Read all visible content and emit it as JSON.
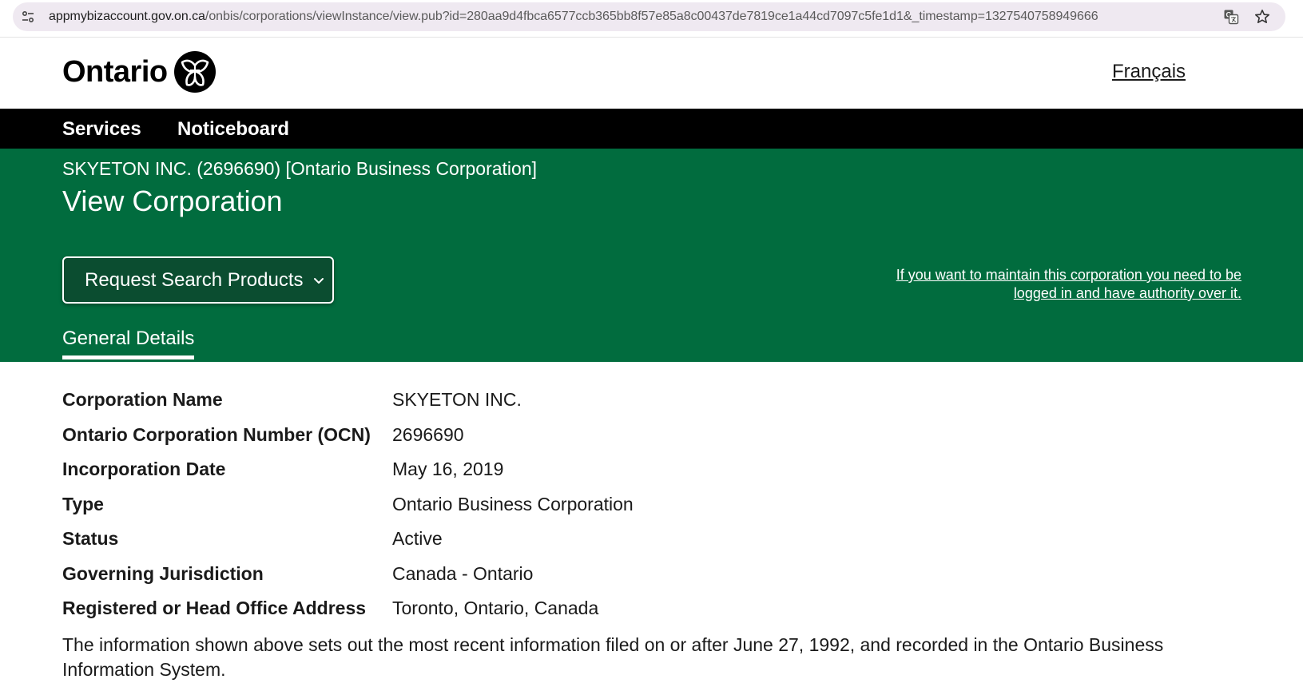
{
  "browser": {
    "url_host": "appmybizaccount.gov.on.ca",
    "url_path": "/onbis/corporations/viewInstance/view.pub?id=280aa9d4fbca6577ccb365bb8f57e85a8c00437de7819ce1a44cd7097c5fe1d1&_timestamp=1327540758949666",
    "icons": [
      "site-info-icon",
      "translate-icon",
      "star-icon"
    ]
  },
  "header": {
    "logo_text": "Ontario",
    "language_link": "Français"
  },
  "nav": {
    "items": [
      {
        "label": "Services"
      },
      {
        "label": "Noticeboard"
      }
    ]
  },
  "banner": {
    "subtitle": "SKYETON INC. (2696690) [Ontario Business Corporation]",
    "title": "View Corporation",
    "request_button": "Request Search Products",
    "maintain_link": "If you want to maintain this corporation you need to be logged in and have authority over it.",
    "tab": "General Details",
    "background_color": "#016c3e"
  },
  "details": {
    "rows": [
      {
        "label": "Corporation Name",
        "value": "SKYETON INC."
      },
      {
        "label": "Ontario Corporation Number (OCN)",
        "value": "2696690"
      },
      {
        "label": "Incorporation Date",
        "value": "May 16, 2019"
      },
      {
        "label": "Type",
        "value": "Ontario Business Corporation"
      },
      {
        "label": "Status",
        "value": "Active"
      },
      {
        "label": "Governing Jurisdiction",
        "value": "Canada - Ontario"
      },
      {
        "label": "Registered or Head Office Address",
        "value": "Toronto, Ontario, Canada"
      }
    ],
    "note": "The information shown above sets out the most recent information filed on or after June 27, 1992, and recorded in the Ontario Business Information System."
  }
}
